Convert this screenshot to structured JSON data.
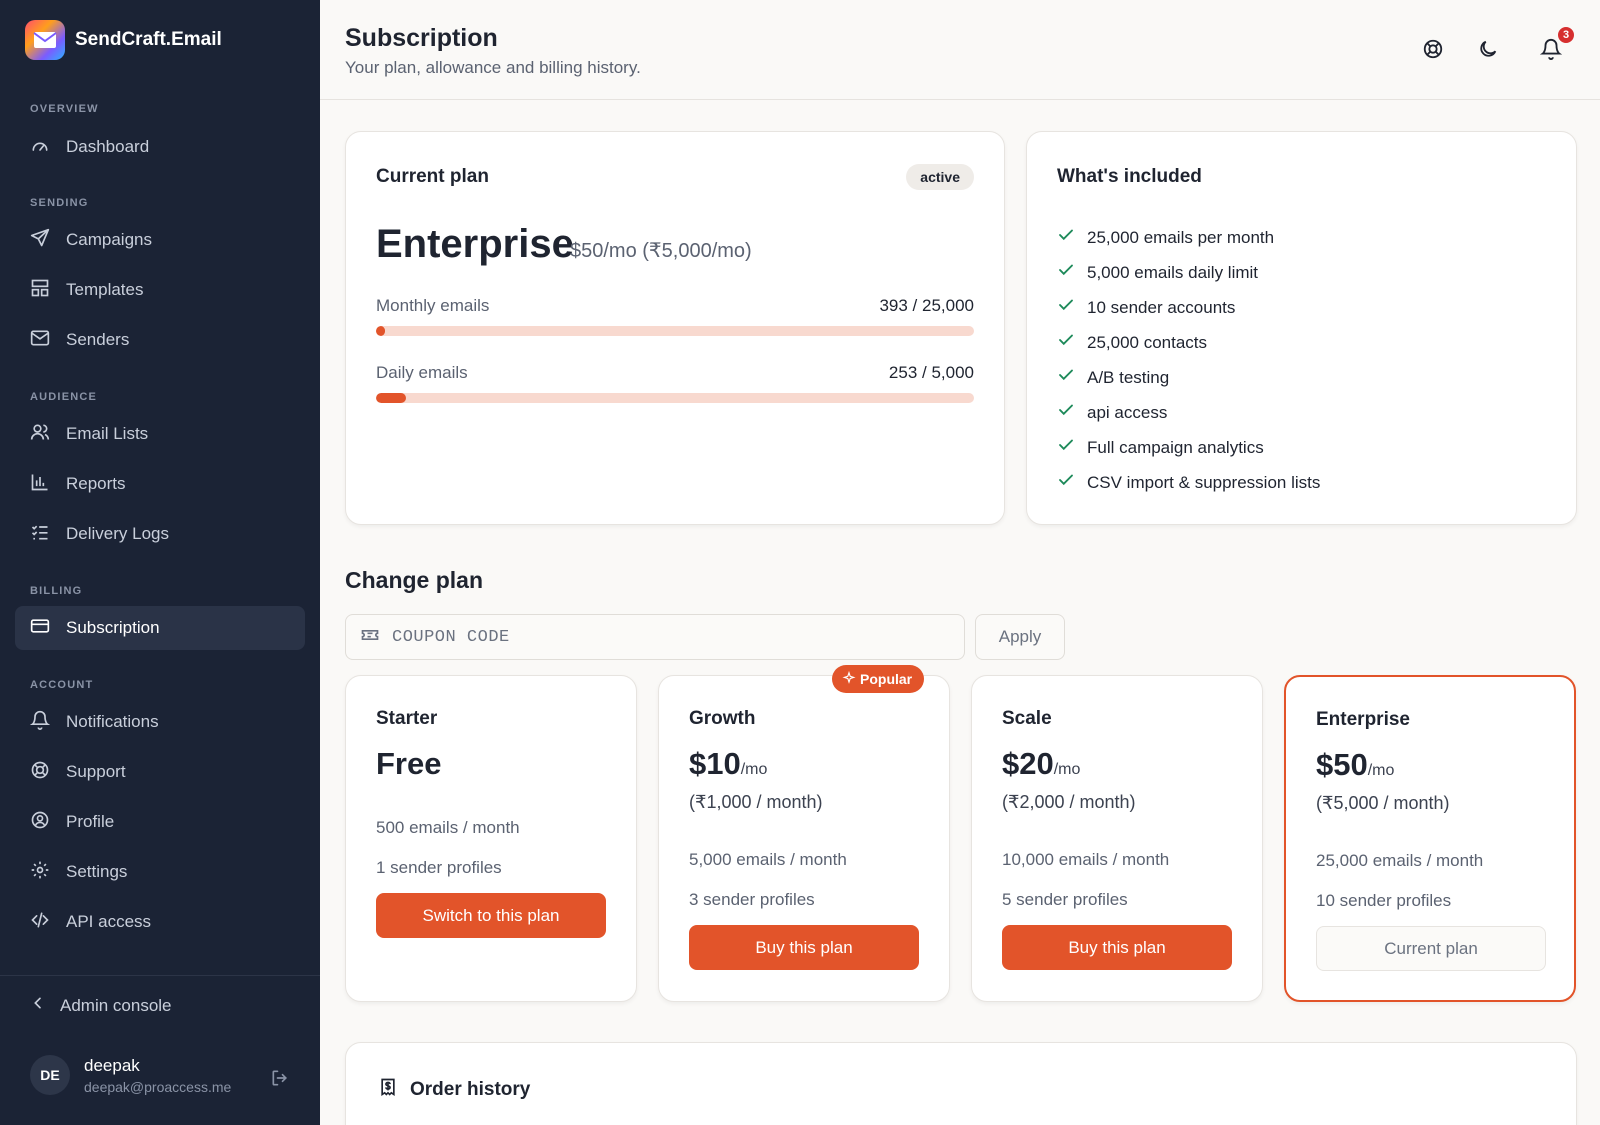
{
  "brand": {
    "name": "SendCraft.Email"
  },
  "sidebar": {
    "sections": [
      "OVERVIEW",
      "SENDING",
      "AUDIENCE",
      "BILLING",
      "ACCOUNT"
    ],
    "items": [
      {
        "label": "Dashboard",
        "icon": "gauge-icon"
      },
      {
        "label": "Campaigns",
        "icon": "send-icon"
      },
      {
        "label": "Templates",
        "icon": "layout-icon"
      },
      {
        "label": "Senders",
        "icon": "mail-icon"
      },
      {
        "label": "Email Lists",
        "icon": "users-icon"
      },
      {
        "label": "Reports",
        "icon": "bar-chart-icon"
      },
      {
        "label": "Delivery Logs",
        "icon": "list-checks-icon"
      },
      {
        "label": "Subscription",
        "icon": "credit-card-icon",
        "active": true
      },
      {
        "label": "Notifications",
        "icon": "bell-icon"
      },
      {
        "label": "Support",
        "icon": "life-buoy-icon"
      },
      {
        "label": "Profile",
        "icon": "user-circle-icon"
      },
      {
        "label": "Settings",
        "icon": "gear-icon"
      },
      {
        "label": "API access",
        "icon": "code-icon"
      }
    ],
    "admin_label": "Admin console",
    "user": {
      "initials": "DE",
      "name": "deepak",
      "email": "deepak@proaccess.me"
    }
  },
  "header": {
    "title": "Subscription",
    "subtitle": "Your plan, allowance and billing history.",
    "notification_count": "3"
  },
  "current_plan": {
    "title": "Current plan",
    "status": "active",
    "name": "Enterprise",
    "price": "$50/mo (₹5,000/mo)",
    "monthly": {
      "label": "Monthly emails",
      "value": "393 / 25,000",
      "fraction": 0.0157
    },
    "daily": {
      "label": "Daily emails",
      "value": "253 / 5,000",
      "fraction": 0.0506
    }
  },
  "included": {
    "title": "What's included",
    "items": [
      "25,000 emails per month",
      "5,000 emails daily limit",
      "10 sender accounts",
      "25,000 contacts",
      "A/B testing",
      "api access",
      "Full campaign analytics",
      "CSV import & suppression lists"
    ]
  },
  "change_plan": {
    "title": "Change plan",
    "coupon_placeholder": "COUPON CODE",
    "apply_label": "Apply",
    "popular_label": "Popular",
    "plans": [
      {
        "name": "Starter",
        "price": "Free",
        "per": "",
        "inr": "",
        "emails": "500 emails / month",
        "senders": "1 sender profiles",
        "button": "Switch to this plan"
      },
      {
        "name": "Growth",
        "price": "$10",
        "per": "/mo",
        "inr": "(₹1,000 / month)",
        "emails": "5,000 emails / month",
        "senders": "3 sender profiles",
        "button": "Buy this plan"
      },
      {
        "name": "Scale",
        "price": "$20",
        "per": "/mo",
        "inr": "(₹2,000 / month)",
        "emails": "10,000 emails / month",
        "senders": "5 sender profiles",
        "button": "Buy this plan"
      },
      {
        "name": "Enterprise",
        "price": "$50",
        "per": "/mo",
        "inr": "(₹5,000 / month)",
        "emails": "25,000 emails / month",
        "senders": "10 sender profiles",
        "button": "Current plan"
      }
    ]
  },
  "order_history": {
    "title": "Order history"
  },
  "colors": {
    "accent": "#e2542a",
    "sidebar_bg": "#1b2335",
    "check": "#1e8a5a"
  }
}
